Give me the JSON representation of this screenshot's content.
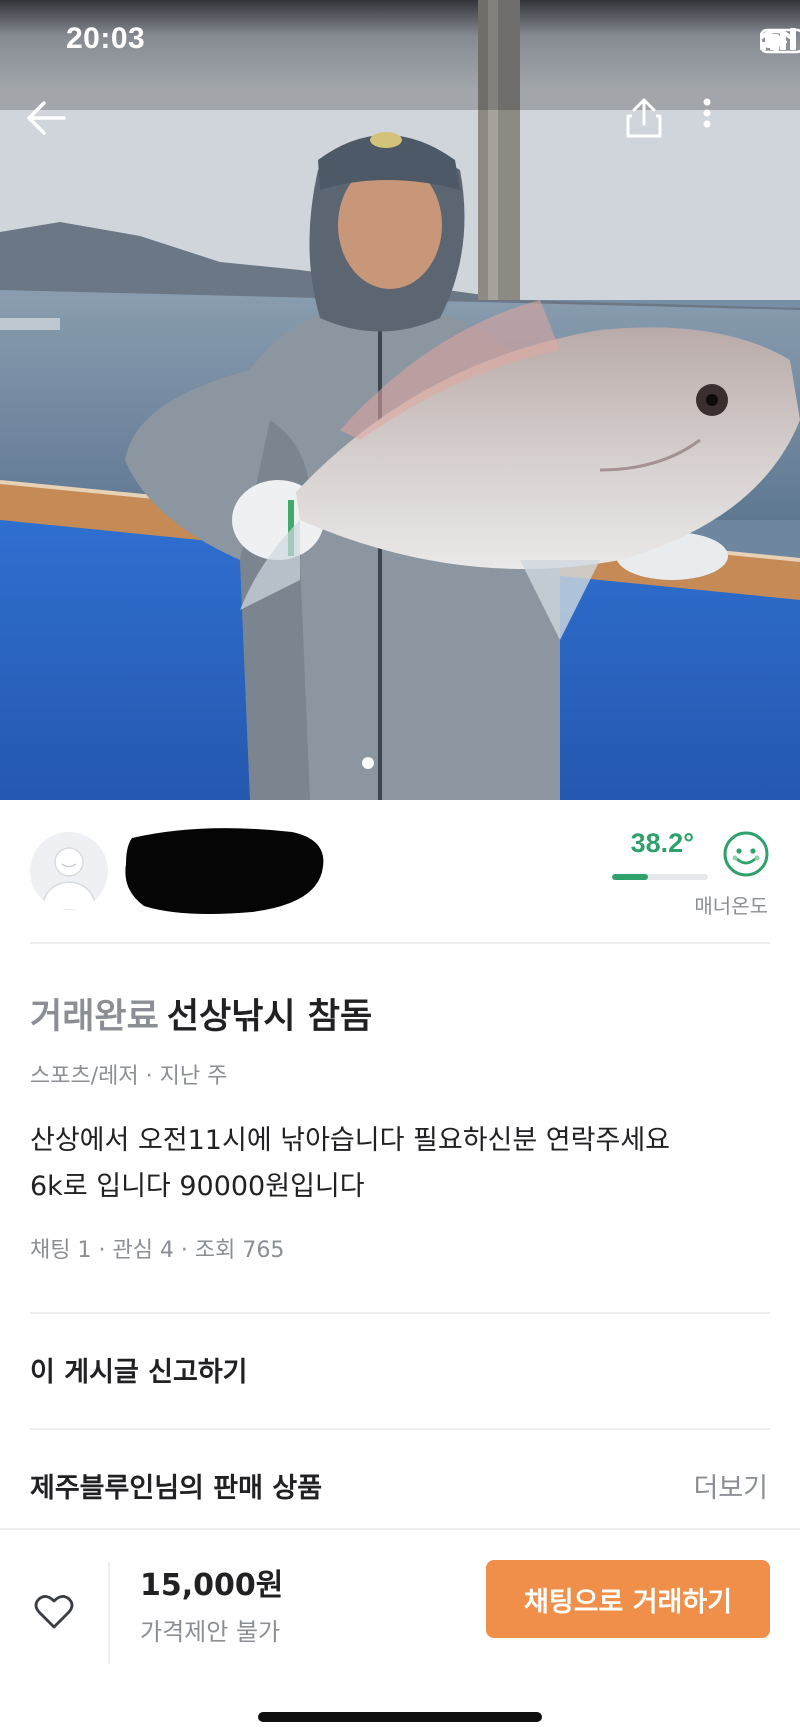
{
  "status_bar": {
    "time": "20:03"
  },
  "seller": {
    "temperature": "38.2°",
    "temperature_fill": 0.38,
    "manner_label": "매너온도"
  },
  "post": {
    "status": "거래완료",
    "title": "선상낚시  참돔",
    "meta": "스포츠/레저 · 지난 주",
    "body_lines": [
      "산상에서  오전11시에   낚아습니다 필요하신분  연락주세요",
      "6k로 입니다  90000원입니다"
    ],
    "stats": "채팅 1 · 관심 4 · 조회 765"
  },
  "report_label": "이 게시글 신고하기",
  "seller_items": {
    "title": "제주블루인님의 판매 상품",
    "more_label": "더보기"
  },
  "bottom_bar": {
    "price": "15,000원",
    "price_offer": "가격제안 불가",
    "chat_button": "채팅으로 거래하기"
  },
  "colors": {
    "accent": "#ef8f49",
    "manner_green": "#2ea26a",
    "muted_text": "#8b8f95"
  },
  "icons": [
    "back-arrow-icon",
    "share-icon",
    "more-vertical-icon",
    "signal-icon",
    "wifi-icon",
    "battery-icon",
    "smile-face-icon",
    "heart-icon"
  ]
}
